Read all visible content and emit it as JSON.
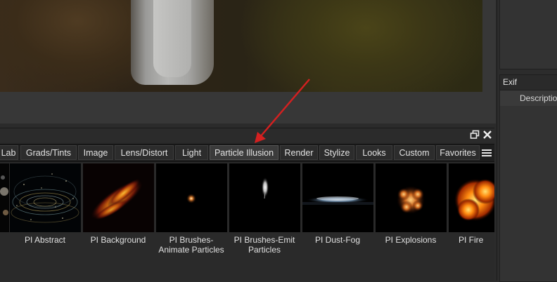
{
  "right_panel": {
    "exif_header": "Exif",
    "exif_rows": [
      "Description"
    ]
  },
  "browser": {
    "tabs": [
      {
        "label": "Lab",
        "active": false
      },
      {
        "label": "Grads/Tints",
        "active": false
      },
      {
        "label": "Image",
        "active": false
      },
      {
        "label": "Lens/Distort",
        "active": false
      },
      {
        "label": "Light",
        "active": false
      },
      {
        "label": "Particle Illusion",
        "active": true
      },
      {
        "label": "Render",
        "active": false
      },
      {
        "label": "Stylize",
        "active": false
      },
      {
        "label": "Looks",
        "active": false
      },
      {
        "label": "Custom",
        "active": false
      },
      {
        "label": "Favorites",
        "active": false
      }
    ],
    "window_buttons": [
      "restore-icon",
      "close-icon"
    ],
    "menu_icon": "hamburger-menu-icon",
    "thumbnails": [
      {
        "label": ""
      },
      {
        "label": "PI Abstract"
      },
      {
        "label": "PI Background"
      },
      {
        "label": "PI Brushes-\nAnimate Particles"
      },
      {
        "label": "PI Brushes-Emit\nParticles"
      },
      {
        "label": "PI Dust-Fog"
      },
      {
        "label": "PI Explosions"
      },
      {
        "label": "PI Fire"
      }
    ]
  },
  "annotation": {
    "type": "red-arrow",
    "color": "#d42020",
    "target": "Particle Illusion"
  }
}
